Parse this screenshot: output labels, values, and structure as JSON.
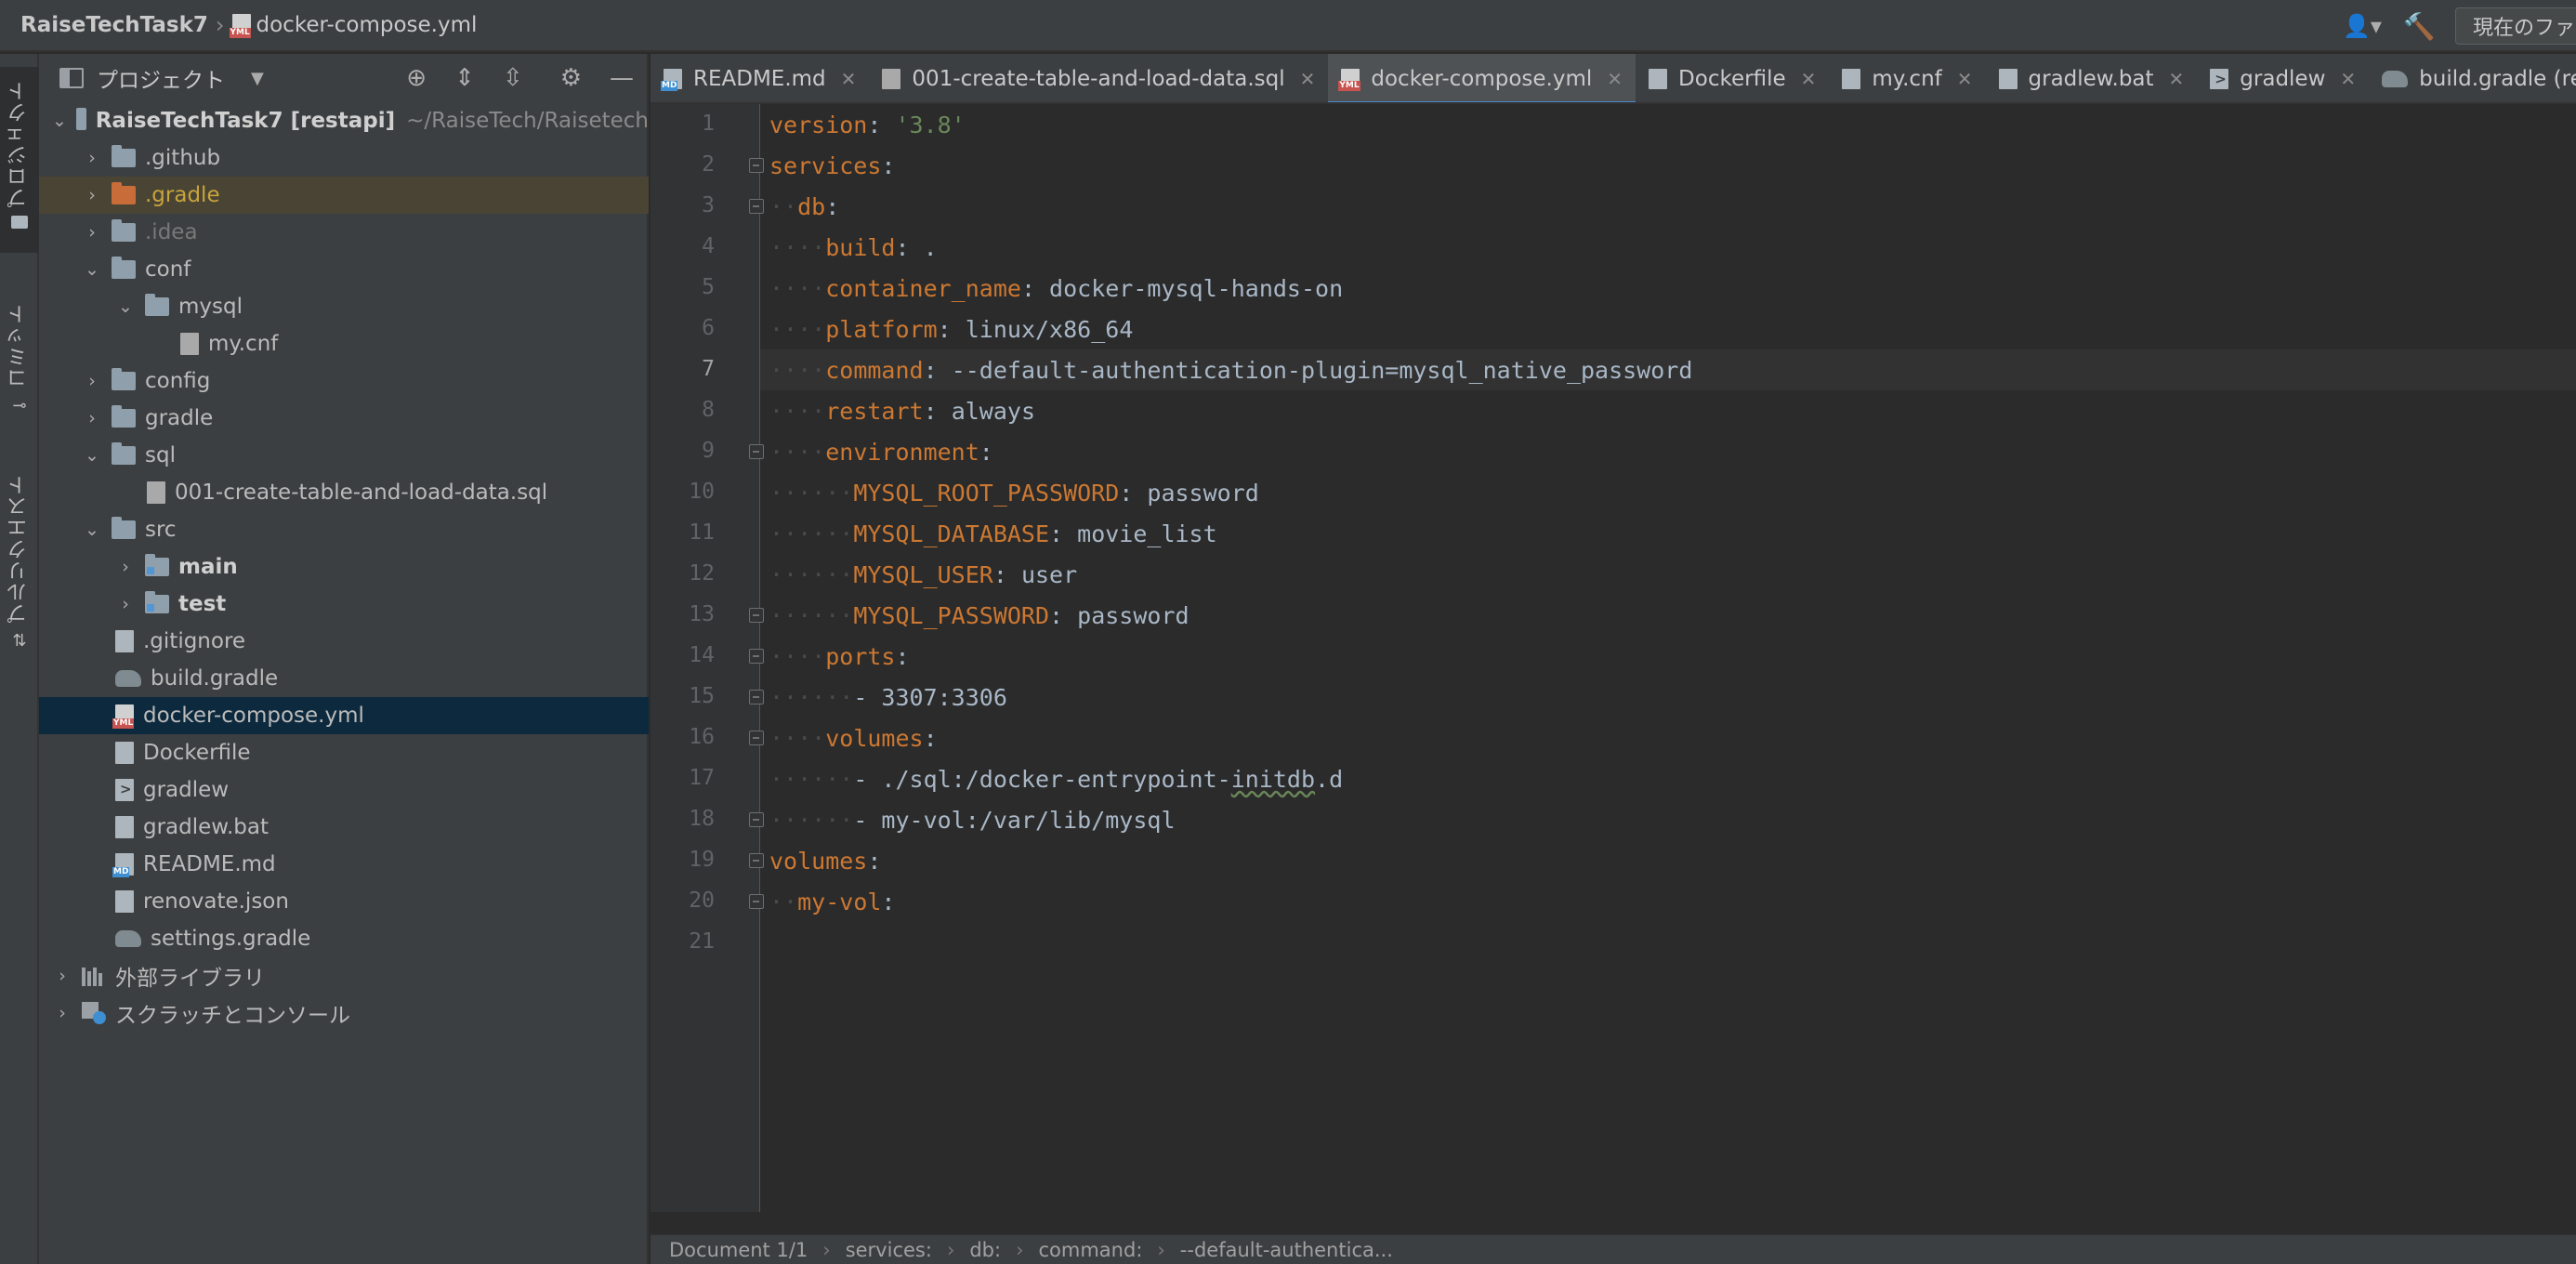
{
  "topbar": {
    "project": "RaiseTechTask7",
    "file": "docker-compose.yml",
    "run_config": "現在のファイ"
  },
  "left_strip": {
    "project_tab": "プロジェクト",
    "commit_tab": "コミット",
    "pr_tab": "プルリクエスト"
  },
  "project_panel": {
    "title": "プロジェクト",
    "root_name": "RaiseTechTask7 [restapi]",
    "root_path": "~/RaiseTech/Raisetech",
    "items": [
      {
        "label": ".github"
      },
      {
        "label": ".gradle"
      },
      {
        "label": ".idea"
      },
      {
        "label": "conf"
      },
      {
        "label": "mysql"
      },
      {
        "label": "my.cnf"
      },
      {
        "label": "config"
      },
      {
        "label": "gradle"
      },
      {
        "label": "sql"
      },
      {
        "label": "001-create-table-and-load-data.sql"
      },
      {
        "label": "src"
      },
      {
        "label": "main"
      },
      {
        "label": "test"
      },
      {
        "label": ".gitignore"
      },
      {
        "label": "build.gradle"
      },
      {
        "label": "docker-compose.yml"
      },
      {
        "label": "Dockerfile"
      },
      {
        "label": "gradlew"
      },
      {
        "label": "gradlew.bat"
      },
      {
        "label": "README.md"
      },
      {
        "label": "renovate.json"
      },
      {
        "label": "settings.gradle"
      },
      {
        "label": "外部ライブラリ"
      },
      {
        "label": "スクラッチとコンソール"
      }
    ]
  },
  "tabs": [
    {
      "label": "README.md"
    },
    {
      "label": "001-create-table-and-load-data.sql"
    },
    {
      "label": "docker-compose.yml"
    },
    {
      "label": "Dockerfile"
    },
    {
      "label": "my.cnf"
    },
    {
      "label": "gradlew.bat"
    },
    {
      "label": "gradlew"
    },
    {
      "label": "build.gradle (res"
    }
  ],
  "editor": {
    "line_numbers": [
      "1",
      "2",
      "3",
      "4",
      "5",
      "6",
      "7",
      "8",
      "9",
      "10",
      "11",
      "12",
      "13",
      "14",
      "15",
      "16",
      "17",
      "18",
      "19",
      "20",
      "21"
    ],
    "code": [
      {
        "key": "version",
        "val": "'3.8'"
      },
      {
        "key": "services",
        "val": ""
      },
      {
        "key": "db",
        "val": ""
      },
      {
        "key": "build",
        "val": "."
      },
      {
        "key": "container_name",
        "val": "docker-mysql-hands-on"
      },
      {
        "key": "platform",
        "val": "linux/x86_64"
      },
      {
        "key": "command",
        "val": "--default-authentication-plugin=mysql_native_password"
      },
      {
        "key": "restart",
        "val": "always"
      },
      {
        "key": "environment",
        "val": ""
      },
      {
        "key": "MYSQL_ROOT_PASSWORD",
        "val": "password"
      },
      {
        "key": "MYSQL_DATABASE",
        "val": "movie_list"
      },
      {
        "key": "MYSQL_USER",
        "val": "user"
      },
      {
        "key": "MYSQL_PASSWORD",
        "val": "password"
      },
      {
        "key": "ports",
        "val": ""
      },
      {
        "item": "3307:3306"
      },
      {
        "key": "volumes",
        "val": ""
      },
      {
        "item": "./sql:/docker-entrypoint-initdb.d"
      },
      {
        "item": "my-vol:/var/lib/mysql"
      },
      {
        "key": "volumes",
        "val": ""
      },
      {
        "key": "my-vol",
        "val": ""
      }
    ]
  },
  "statusbar": {
    "doc": "Document 1/1",
    "c1": "services:",
    "c2": "db:",
    "c3": "command:",
    "c4": "--default-authentica..."
  }
}
